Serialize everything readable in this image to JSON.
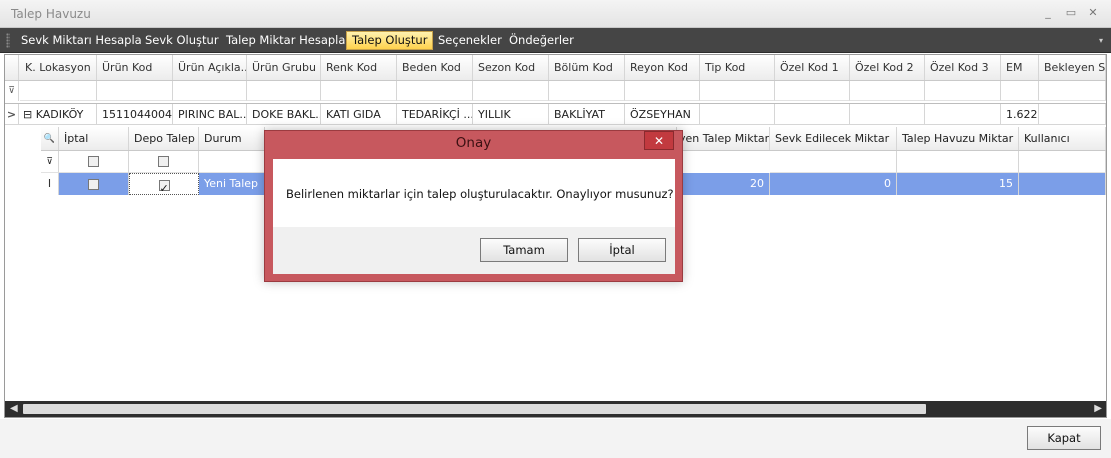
{
  "window": {
    "title": "Talep Havuzu",
    "minimize": "_",
    "restore": "▭",
    "close": "✕"
  },
  "menu": {
    "items": [
      "Sevk Miktarı Hesapla",
      "Sevk Oluştur",
      "Talep Miktar Hesapla",
      "Talep Oluştur",
      "Seçenekler",
      "Öndeğerler"
    ],
    "active_index": 3,
    "caret": "▾"
  },
  "grid": {
    "columns": [
      "K. Lokasyon",
      "Ürün Kod",
      "Ürün Açıkla...",
      "Ürün Grubu",
      "Renk Kod",
      "Beden Kod",
      "Sezon Kod",
      "Bölüm Kod",
      "Reyon Kod",
      "Tip Kod",
      "Özel Kod 1",
      "Özel Kod 2",
      "Özel Kod 3",
      "EM",
      "Bekleyen Sipa"
    ],
    "filter_icon": "⊽",
    "row": {
      "expand_icon": "⊟",
      "indicator": ">",
      "cells": [
        "KADIKÖY",
        "1511044004",
        "PIRINC BAL...",
        "DOKE BAKL...",
        "KATI GIDA",
        "TEDARİKÇİ ...",
        "YILLIK",
        "BAKLİYAT",
        "ÖZSEYHAN",
        "",
        "",
        "",
        "",
        "1.622",
        ""
      ]
    },
    "detail": {
      "search_icon": "🔍",
      "columns_left": [
        "İptal",
        "Depo Talep",
        "Durum"
      ],
      "columns_right": [
        "yen Talep Miktar",
        "Sevk Edilecek Miktar",
        "Talep Havuzu Miktar",
        "Kullanıcı"
      ],
      "row_indicator": "I",
      "row": {
        "iptal_checked": false,
        "depo_talep_checked": true,
        "durum": "Yeni Talep",
        "values_right": [
          "20",
          "0",
          "15",
          ""
        ]
      }
    },
    "scroll": {
      "left_arrow": "◀",
      "right_arrow": "▶"
    }
  },
  "footer": {
    "close_label": "Kapat"
  },
  "dialog": {
    "title": "Onay",
    "close": "✕",
    "message": "Belirlenen miktarlar için talep oluşturulacaktır. Onaylıyor musunuz?",
    "ok_label": "Tamam",
    "cancel_label": "İptal"
  }
}
